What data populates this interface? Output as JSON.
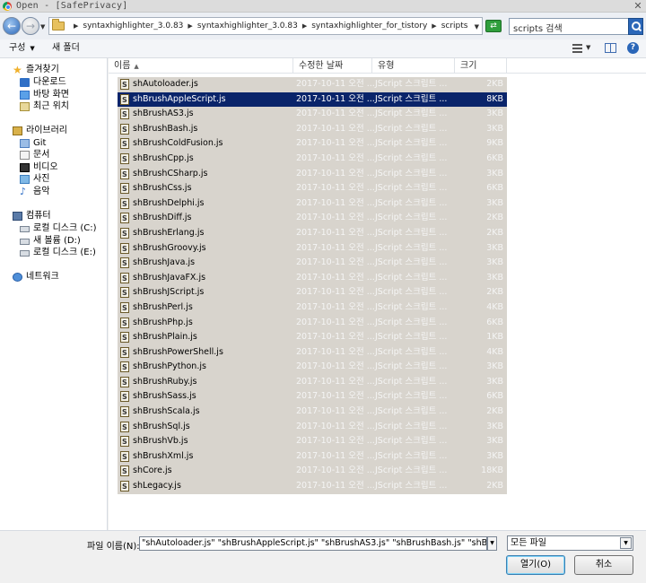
{
  "window": {
    "title": "Open - [SafePrivacy]",
    "close_glyph": "✕"
  },
  "address": {
    "crumbs": [
      "syntaxhighlighter_3.0.83",
      "syntaxhighlighter_3.0.83",
      "syntaxhighlighter_for_tistory",
      "scripts"
    ],
    "search_placeholder": "scripts 검색"
  },
  "toolbar": {
    "organize_label": "구성",
    "new_folder_label": "새 폴더"
  },
  "sidebar": {
    "favorites": {
      "label": "즐겨찾기",
      "icon": "star-icon"
    },
    "favorite_items": [
      {
        "label": "다운로드",
        "icon": "downloads-icon"
      },
      {
        "label": "바탕 화면",
        "icon": "desktop-icon"
      },
      {
        "label": "최근 위치",
        "icon": "recent-places-icon"
      }
    ],
    "libraries": {
      "label": "라이브러리",
      "icon": "library-icon"
    },
    "library_items": [
      {
        "label": "Git",
        "icon": "git-library-icon"
      },
      {
        "label": "문서",
        "icon": "documents-icon"
      },
      {
        "label": "비디오",
        "icon": "videos-icon"
      },
      {
        "label": "사진",
        "icon": "pictures-icon"
      },
      {
        "label": "음악",
        "icon": "music-icon"
      }
    ],
    "computer": {
      "label": "컴퓨터",
      "icon": "computer-icon"
    },
    "drives": [
      {
        "label": "로컬 디스크 (C:)",
        "icon": "drive-icon"
      },
      {
        "label": "새 볼륨 (D:)",
        "icon": "drive-icon"
      },
      {
        "label": "로컬 디스크 (E:)",
        "icon": "drive-icon"
      }
    ],
    "network": {
      "label": "네트워크",
      "icon": "network-icon"
    }
  },
  "columns": {
    "name": "이름",
    "date": "수정한 날짜",
    "type": "유형",
    "size": "크기"
  },
  "files": [
    {
      "name": "shAutoloader.js",
      "date": "2017-10-11 오전 ...",
      "type": "JScript 스크립트 ...",
      "size": "2KB"
    },
    {
      "name": "shBrushAppleScript.js",
      "date": "2017-10-11 오전 ...",
      "type": "JScript 스크립트 ...",
      "size": "8KB",
      "selected": true
    },
    {
      "name": "shBrushAS3.js",
      "date": "2017-10-11 오전 ...",
      "type": "JScript 스크립트 ...",
      "size": "3KB"
    },
    {
      "name": "shBrushBash.js",
      "date": "2017-10-11 오전 ...",
      "type": "JScript 스크립트 ...",
      "size": "3KB"
    },
    {
      "name": "shBrushColdFusion.js",
      "date": "2017-10-11 오전 ...",
      "type": "JScript 스크립트 ...",
      "size": "9KB"
    },
    {
      "name": "shBrushCpp.js",
      "date": "2017-10-11 오전 ...",
      "type": "JScript 스크립트 ...",
      "size": "6KB"
    },
    {
      "name": "shBrushCSharp.js",
      "date": "2017-10-11 오전 ...",
      "type": "JScript 스크립트 ...",
      "size": "3KB"
    },
    {
      "name": "shBrushCss.js",
      "date": "2017-10-11 오전 ...",
      "type": "JScript 스크립트 ...",
      "size": "6KB"
    },
    {
      "name": "shBrushDelphi.js",
      "date": "2017-10-11 오전 ...",
      "type": "JScript 스크립트 ...",
      "size": "3KB"
    },
    {
      "name": "shBrushDiff.js",
      "date": "2017-10-11 오전 ...",
      "type": "JScript 스크립트 ...",
      "size": "2KB"
    },
    {
      "name": "shBrushErlang.js",
      "date": "2017-10-11 오전 ...",
      "type": "JScript 스크립트 ...",
      "size": "2KB"
    },
    {
      "name": "shBrushGroovy.js",
      "date": "2017-10-11 오전 ...",
      "type": "JScript 스크립트 ...",
      "size": "3KB"
    },
    {
      "name": "shBrushJava.js",
      "date": "2017-10-11 오전 ...",
      "type": "JScript 스크립트 ...",
      "size": "3KB"
    },
    {
      "name": "shBrushJavaFX.js",
      "date": "2017-10-11 오전 ...",
      "type": "JScript 스크립트 ...",
      "size": "3KB"
    },
    {
      "name": "shBrushJScript.js",
      "date": "2017-10-11 오전 ...",
      "type": "JScript 스크립트 ...",
      "size": "2KB"
    },
    {
      "name": "shBrushPerl.js",
      "date": "2017-10-11 오전 ...",
      "type": "JScript 스크립트 ...",
      "size": "4KB"
    },
    {
      "name": "shBrushPhp.js",
      "date": "2017-10-11 오전 ...",
      "type": "JScript 스크립트 ...",
      "size": "6KB"
    },
    {
      "name": "shBrushPlain.js",
      "date": "2017-10-11 오전 ...",
      "type": "JScript 스크립트 ...",
      "size": "1KB"
    },
    {
      "name": "shBrushPowerShell.js",
      "date": "2017-10-11 오전 ...",
      "type": "JScript 스크립트 ...",
      "size": "4KB"
    },
    {
      "name": "shBrushPython.js",
      "date": "2017-10-11 오전 ...",
      "type": "JScript 스크립트 ...",
      "size": "3KB"
    },
    {
      "name": "shBrushRuby.js",
      "date": "2017-10-11 오전 ...",
      "type": "JScript 스크립트 ...",
      "size": "3KB"
    },
    {
      "name": "shBrushSass.js",
      "date": "2017-10-11 오전 ...",
      "type": "JScript 스크립트 ...",
      "size": "6KB"
    },
    {
      "name": "shBrushScala.js",
      "date": "2017-10-11 오전 ...",
      "type": "JScript 스크립트 ...",
      "size": "2KB"
    },
    {
      "name": "shBrushSql.js",
      "date": "2017-10-11 오전 ...",
      "type": "JScript 스크립트 ...",
      "size": "3KB"
    },
    {
      "name": "shBrushVb.js",
      "date": "2017-10-11 오전 ...",
      "type": "JScript 스크립트 ...",
      "size": "3KB"
    },
    {
      "name": "shBrushXml.js",
      "date": "2017-10-11 오전 ...",
      "type": "JScript 스크립트 ...",
      "size": "3KB"
    },
    {
      "name": "shCore.js",
      "date": "2017-10-11 오전 ...",
      "type": "JScript 스크립트 ...",
      "size": "18KB"
    },
    {
      "name": "shLegacy.js",
      "date": "2017-10-11 오전 ...",
      "type": "JScript 스크립트 ...",
      "size": "2KB"
    }
  ],
  "footer": {
    "filename_label": "파일 이름(N):",
    "filename_value": "\"shAutoloader.js\" \"shBrushAppleScript.js\" \"shBrushAS3.js\" \"shBrushBash.js\" \"shBrushColdFusio",
    "filetype_value": "모든 파일",
    "open_label": "열기(O)",
    "cancel_label": "취소"
  },
  "colors": {
    "selection": "#0a246a",
    "file_list_bg": "#d8d4cd"
  }
}
